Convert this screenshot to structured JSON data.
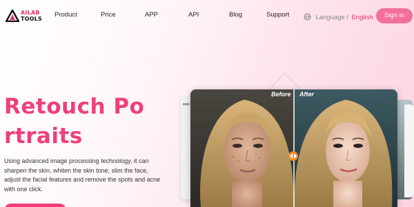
{
  "brand": {
    "line1": "AILAB",
    "line2": "TOOLS",
    "accent": "#e8336b"
  },
  "nav": {
    "items": [
      "Product",
      "Price",
      "APP",
      "API",
      "Blog",
      "Support"
    ],
    "language_label": "Language /",
    "language_value": "English",
    "signin_label": "Sign in"
  },
  "hero": {
    "title_line1": "Retouch Po",
    "title_line2": "rtraits",
    "description": "Using advanced image processing technology, it can sharpen the skin, whiten the skin tone, slim the face, adjust the facial features and remove the spots and acne with one click."
  },
  "comparison": {
    "before_label": "Before",
    "after_label": "After"
  },
  "icons": {
    "logo": "ailab-logo-icon",
    "language": "globe-icon",
    "slider": "compare-slider-icon"
  },
  "colors": {
    "title": "#ef3f7b",
    "signin": "#f2709a",
    "slider": "#f08a2c"
  }
}
